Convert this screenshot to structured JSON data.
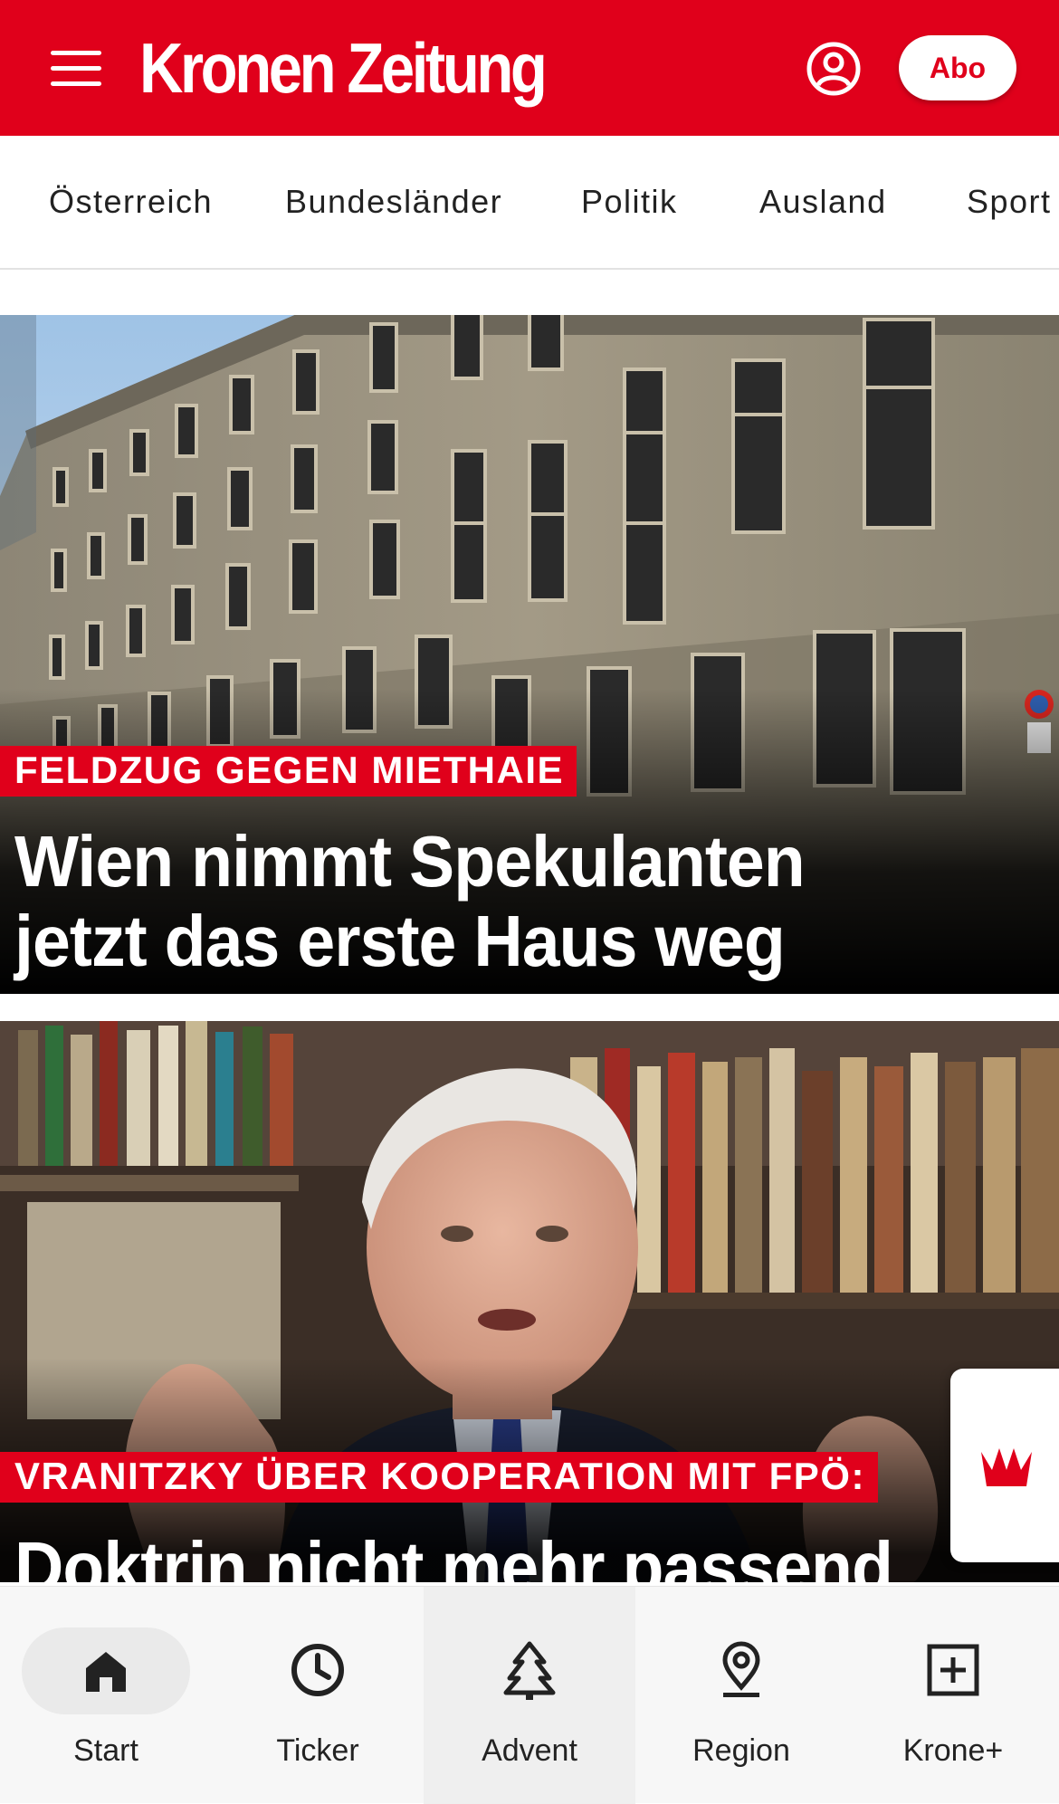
{
  "header": {
    "logo_text": "Kronen Zeitung",
    "abo_label": "Abo"
  },
  "categories": [
    "Österreich",
    "Bundesländer",
    "Politik",
    "Ausland",
    "Sport"
  ],
  "articles": [
    {
      "kicker": "FELDZUG GEGEN MIETHAIE",
      "headline_line1": "Wien nimmt Spekulanten",
      "headline_line2": "jetzt das erste Haus weg"
    },
    {
      "kicker": "VRANITZKY ÜBER KOOPERATION MIT FPÖ:",
      "headline_line1": "Doktrin nicht mehr passend"
    }
  ],
  "bottom_nav": [
    {
      "label": "Start",
      "icon": "home-icon",
      "active": true
    },
    {
      "label": "Ticker",
      "icon": "clock-icon"
    },
    {
      "label": "Advent",
      "icon": "tree-icon"
    },
    {
      "label": "Region",
      "icon": "location-pin-icon"
    },
    {
      "label": "Krone+",
      "icon": "plus-box-icon"
    }
  ],
  "colors": {
    "brand_red": "#e0001b",
    "white": "#ffffff",
    "nav_bg": "#f7f7f7"
  }
}
